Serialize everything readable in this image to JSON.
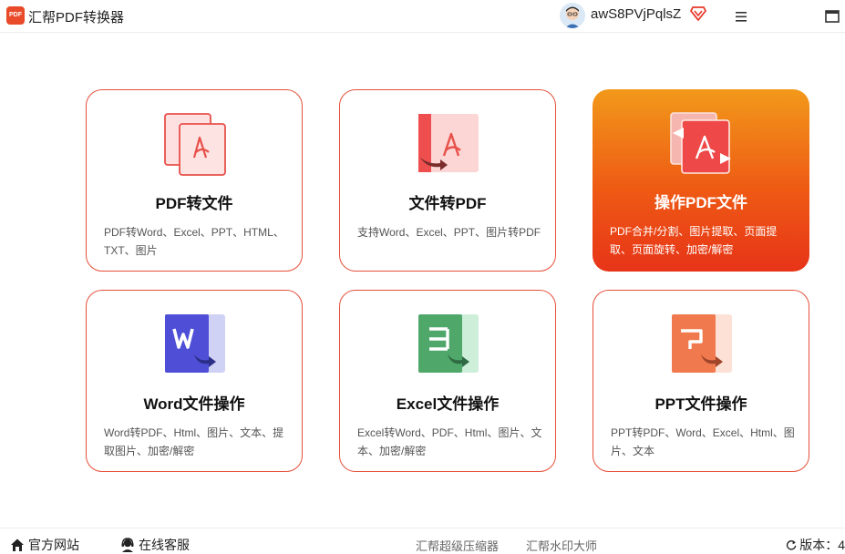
{
  "app": {
    "logo_text": "PDF",
    "title": "汇帮PDF转换器",
    "username": "awS8PVjPqlsZ",
    "brand_color": "#e84a2a"
  },
  "cards": [
    {
      "title": "PDF转文件",
      "desc": "PDF转Word、Excel、PPT、HTML、TXT、图片",
      "icon": "pdf-to-file-icon"
    },
    {
      "title": "文件转PDF",
      "desc": "支持Word、Excel、PPT、图片转PDF",
      "icon": "file-to-pdf-icon"
    },
    {
      "title": "操作PDF文件",
      "desc": "PDF合并/分割、图片提取、页面提取、页面旋转、加密/解密",
      "icon": "pdf-operations-icon",
      "selected": true
    },
    {
      "title": "Word文件操作",
      "desc": "Word转PDF、Html、图片、文本、提取图片、加密/解密",
      "icon": "word-icon"
    },
    {
      "title": "Excel文件操作",
      "desc": "Excel转Word、PDF、Html、图片、文本、加密/解密",
      "icon": "excel-icon"
    },
    {
      "title": "PPT文件操作",
      "desc": "PPT转PDF、Word、Excel、Html、图片、文本",
      "icon": "ppt-icon"
    }
  ],
  "footer": {
    "official_site": "官方网站",
    "online_support": "在线客服",
    "link1": "汇帮超级压缩器",
    "link2": "汇帮水印大师",
    "version": "版本：4"
  }
}
